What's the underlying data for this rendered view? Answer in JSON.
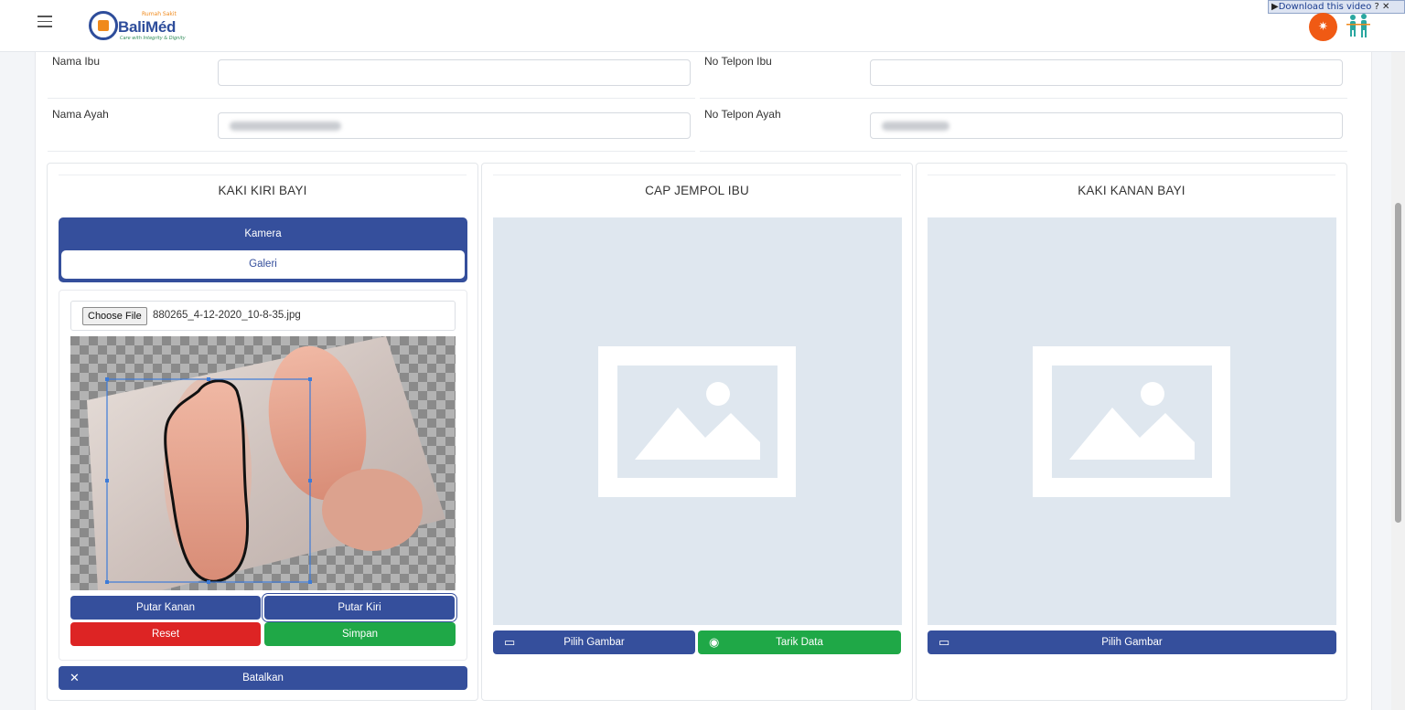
{
  "header": {
    "logo_small": "Rumah Sakit",
    "logo_name": "BaliMéd",
    "logo_tagline": "Care with Integrity & Dignity",
    "download_bar": "Download this video",
    "download_bar_extra": "?",
    "theme_icon": "sun-icon",
    "accent_color": "#f05a14"
  },
  "form": {
    "nama_ibu": {
      "label": "Nama Ibu",
      "value": ""
    },
    "no_telpon_ibu": {
      "label": "No Telpon Ibu",
      "value": ""
    },
    "nama_ayah": {
      "label": "Nama Ayah"
    },
    "no_telpon_ayah": {
      "label": "No Telpon Ayah"
    }
  },
  "panels": {
    "left": {
      "title": "KAKI KIRI BAYI",
      "tab_kamera": "Kamera",
      "tab_galeri": "Galeri",
      "file_button": "Choose File",
      "file_name": "880265_4-12-2020_10-8-35.jpg",
      "btn_putar_kanan": "Putar Kanan",
      "btn_putar_kiri": "Putar Kiri",
      "btn_reset": "Reset",
      "btn_simpan": "Simpan",
      "btn_batalkan": "Batalkan"
    },
    "middle": {
      "title": "CAP JEMPOL IBU",
      "btn_pilih_gambar": "Pilih Gambar",
      "btn_tarik_data": "Tarik Data"
    },
    "right": {
      "title": "KAKI KANAN BAYI",
      "btn_pilih_gambar": "Pilih Gambar"
    }
  },
  "colors": {
    "primary": "#354f9c",
    "danger": "#dd2424",
    "success": "#1fa847",
    "placeholder_bg": "#dfe7ef"
  }
}
